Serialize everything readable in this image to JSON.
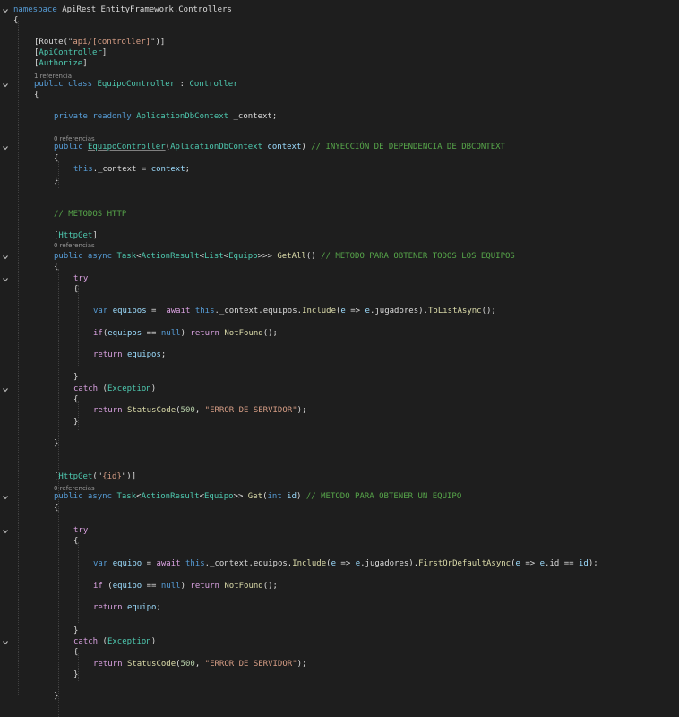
{
  "editor": {
    "lines": [
      [
        [
          "kw",
          "namespace"
        ],
        [
          "tx",
          " ApiRest_EntityFramework.Controllers"
        ]
      ],
      [
        [
          "tx",
          "{"
        ]
      ],
      [
        [
          "tx",
          "[Route(\""
        ],
        [
          "st",
          "api/[controller]"
        ],
        [
          "tx",
          "\")]"
        ]
      ],
      [
        [
          "tx",
          "["
        ],
        [
          "at",
          "ApiController"
        ],
        [
          "tx",
          "]"
        ]
      ],
      [
        [
          "tx",
          "["
        ],
        [
          "at",
          "Authorize"
        ],
        [
          "tx",
          "]"
        ]
      ],
      [
        [
          "kw",
          "public class "
        ],
        [
          "ty",
          "EquipoController"
        ],
        [
          "tx",
          " : "
        ],
        [
          "ty",
          "Controller"
        ]
      ],
      [
        [
          "tx",
          "{"
        ]
      ],
      [
        [
          "kw",
          "private readonly "
        ],
        [
          "ty",
          "AplicationDbContext"
        ],
        [
          "tx",
          " _context;"
        ]
      ],
      [
        [
          "kw",
          "public "
        ],
        [
          "ty",
          "EquipoController"
        ],
        [
          "tx",
          "("
        ],
        [
          "ty",
          "AplicationDbContext"
        ],
        [
          "pr",
          " context"
        ],
        [
          "tx",
          ") "
        ],
        [
          "cm",
          "// INYECCIÓN DE DEPENDENCIA DE DBCONTEXT"
        ]
      ],
      [
        [
          "tx",
          "{"
        ]
      ],
      [
        [
          "kw",
          "this"
        ],
        [
          "tx",
          "._context = "
        ],
        [
          "pr",
          "context"
        ],
        [
          "tx",
          ";"
        ]
      ],
      [
        [
          "tx",
          "}"
        ]
      ],
      [
        [
          "cm",
          "// METODOS HTTP"
        ]
      ],
      [
        [
          "tx",
          "["
        ],
        [
          "at",
          "HttpGet"
        ],
        [
          "tx",
          "]"
        ]
      ],
      [
        [
          "kw",
          "public async "
        ],
        [
          "ty",
          "Task"
        ],
        [
          "tx",
          "<"
        ],
        [
          "ty",
          "ActionResult"
        ],
        [
          "tx",
          "<"
        ],
        [
          "ty",
          "List"
        ],
        [
          "tx",
          "<"
        ],
        [
          "ty",
          "Equipo"
        ],
        [
          "tx",
          ">>> "
        ],
        [
          "fn",
          "GetAll"
        ],
        [
          "tx",
          "() "
        ],
        [
          "cm",
          "// METODO PARA OBTENER TODOS LOS EQUIPOS"
        ]
      ],
      [
        [
          "tx",
          "{"
        ]
      ],
      [
        [
          "ct",
          "try"
        ]
      ],
      [
        [
          "tx",
          "{"
        ]
      ],
      [
        [
          "kw",
          "var "
        ],
        [
          "pr",
          "equipos"
        ],
        [
          "tx",
          " =  "
        ],
        [
          "ct",
          "await "
        ],
        [
          "kw",
          "this"
        ],
        [
          "tx",
          "._context.equipos."
        ],
        [
          "fn",
          "Include"
        ],
        [
          "tx",
          "("
        ],
        [
          "pr",
          "e"
        ],
        [
          "tx",
          " => "
        ],
        [
          "pr",
          "e"
        ],
        [
          "tx",
          ".jugadores)."
        ],
        [
          "fn",
          "ToListAsync"
        ],
        [
          "tx",
          "();"
        ]
      ],
      [
        [
          "ct",
          "if"
        ],
        [
          "tx",
          "("
        ],
        [
          "pr",
          "equipos"
        ],
        [
          "tx",
          " == "
        ],
        [
          "kw",
          "null"
        ],
        [
          "tx",
          ") "
        ],
        [
          "ct",
          "return "
        ],
        [
          "fn",
          "NotFound"
        ],
        [
          "tx",
          "();"
        ]
      ],
      [
        [
          "ct",
          "return "
        ],
        [
          "pr",
          "equipos"
        ],
        [
          "tx",
          ";"
        ]
      ],
      [
        [
          "tx",
          "}"
        ]
      ],
      [
        [
          "ct",
          "catch"
        ],
        [
          "tx",
          " ("
        ],
        [
          "ty",
          "Exception"
        ],
        [
          "tx",
          ")"
        ]
      ],
      [
        [
          "tx",
          "{"
        ]
      ],
      [
        [
          "ct",
          "return "
        ],
        [
          "fn",
          "StatusCode"
        ],
        [
          "tx",
          "("
        ],
        [
          "nm",
          "500"
        ],
        [
          "tx",
          ", "
        ],
        [
          "st",
          "\"ERROR DE SERVIDOR\""
        ],
        [
          "tx",
          ");"
        ]
      ],
      [
        [
          "tx",
          "}"
        ]
      ],
      [
        [
          "tx",
          "}"
        ]
      ],
      [
        [
          "tx",
          "["
        ],
        [
          "at",
          "HttpGet"
        ],
        [
          "tx",
          "(\""
        ],
        [
          "st",
          "{id}"
        ],
        [
          "tx",
          "\")]"
        ]
      ],
      [
        [
          "kw",
          "public async "
        ],
        [
          "ty",
          "Task"
        ],
        [
          "tx",
          "<"
        ],
        [
          "ty",
          "ActionResult"
        ],
        [
          "tx",
          "<"
        ],
        [
          "ty",
          "Equipo"
        ],
        [
          "tx",
          ">> "
        ],
        [
          "fn",
          "Get"
        ],
        [
          "tx",
          "("
        ],
        [
          "kw",
          "int"
        ],
        [
          "pr",
          " id"
        ],
        [
          "tx",
          ") "
        ],
        [
          "cm",
          "// METODO PARA OBTENER UN EQUIPO"
        ]
      ],
      [
        [
          "tx",
          "{"
        ]
      ],
      [
        [
          "ct",
          "try"
        ]
      ],
      [
        [
          "tx",
          "{"
        ]
      ],
      [
        [
          "kw",
          "var "
        ],
        [
          "pr",
          "equipo"
        ],
        [
          "tx",
          " = "
        ],
        [
          "ct",
          "await "
        ],
        [
          "kw",
          "this"
        ],
        [
          "tx",
          "._context.equipos."
        ],
        [
          "fn",
          "Include"
        ],
        [
          "tx",
          "("
        ],
        [
          "pr",
          "e"
        ],
        [
          "tx",
          " => "
        ],
        [
          "pr",
          "e"
        ],
        [
          "tx",
          ".jugadores)."
        ],
        [
          "fn",
          "FirstOrDefaultAsync"
        ],
        [
          "tx",
          "("
        ],
        [
          "pr",
          "e"
        ],
        [
          "tx",
          " => "
        ],
        [
          "pr",
          "e"
        ],
        [
          "tx",
          ".id == "
        ],
        [
          "pr",
          "id"
        ],
        [
          "tx",
          ");"
        ]
      ],
      [
        [
          "ct",
          "if"
        ],
        [
          "tx",
          " ("
        ],
        [
          "pr",
          "equipo"
        ],
        [
          "tx",
          " == "
        ],
        [
          "kw",
          "null"
        ],
        [
          "tx",
          ") "
        ],
        [
          "ct",
          "return "
        ],
        [
          "fn",
          "NotFound"
        ],
        [
          "tx",
          "();"
        ]
      ],
      [
        [
          "ct",
          "return "
        ],
        [
          "pr",
          "equipo"
        ],
        [
          "tx",
          ";"
        ]
      ],
      [
        [
          "tx",
          "}"
        ]
      ],
      [
        [
          "ct",
          "catch"
        ],
        [
          "tx",
          " ("
        ],
        [
          "ty",
          "Exception"
        ],
        [
          "tx",
          ")"
        ]
      ],
      [
        [
          "tx",
          "{"
        ]
      ],
      [
        [
          "ct",
          "return "
        ],
        [
          "fn",
          "StatusCode"
        ],
        [
          "tx",
          "("
        ],
        [
          "nm",
          "500"
        ],
        [
          "tx",
          ", "
        ],
        [
          "st",
          "\"ERROR DE SERVIDOR\""
        ],
        [
          "tx",
          ");"
        ]
      ],
      [
        [
          "tx",
          "}"
        ]
      ],
      [
        [
          "tx",
          "}"
        ]
      ]
    ],
    "references": [
      "1 referencia",
      "0 referencias",
      "0 referencias",
      "0 referencias"
    ]
  }
}
